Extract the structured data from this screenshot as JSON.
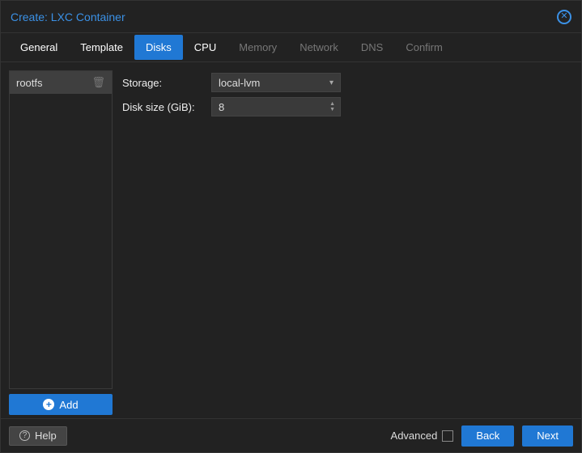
{
  "title": "Create: LXC Container",
  "tabs": [
    {
      "label": "General",
      "state": "enabled"
    },
    {
      "label": "Template",
      "state": "enabled"
    },
    {
      "label": "Disks",
      "state": "active"
    },
    {
      "label": "CPU",
      "state": "enabled"
    },
    {
      "label": "Memory",
      "state": "disabled"
    },
    {
      "label": "Network",
      "state": "disabled"
    },
    {
      "label": "DNS",
      "state": "disabled"
    },
    {
      "label": "Confirm",
      "state": "disabled"
    }
  ],
  "sidebar": {
    "items": [
      {
        "label": "rootfs"
      }
    ],
    "add_label": "Add"
  },
  "form": {
    "storage": {
      "label": "Storage:",
      "value": "local-lvm"
    },
    "disk_size": {
      "label": "Disk size (GiB):",
      "value": "8"
    }
  },
  "footer": {
    "help_label": "Help",
    "advanced_label": "Advanced",
    "advanced_checked": false,
    "back_label": "Back",
    "next_label": "Next"
  }
}
